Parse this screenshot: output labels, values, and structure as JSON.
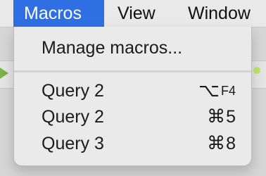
{
  "menubar": {
    "items": [
      {
        "label": "Macros",
        "active": true
      },
      {
        "label": "View",
        "active": false
      },
      {
        "label": "Window",
        "active": false
      }
    ]
  },
  "menu": {
    "items": [
      {
        "label": "Manage macros...",
        "shortcut_modifier": "",
        "shortcut_key": ""
      },
      {
        "label": "Query 2",
        "shortcut_modifier": "⌥",
        "shortcut_key": "F4"
      },
      {
        "label": "Query 2",
        "shortcut_modifier": "⌘",
        "shortcut_key": "5"
      },
      {
        "label": "Query 3",
        "shortcut_modifier": "⌘",
        "shortcut_key": "8"
      }
    ]
  },
  "colors": {
    "accent": "#2F6FE4",
    "menu_background": "#EAEAEA",
    "separator": "#D3D3D3"
  }
}
